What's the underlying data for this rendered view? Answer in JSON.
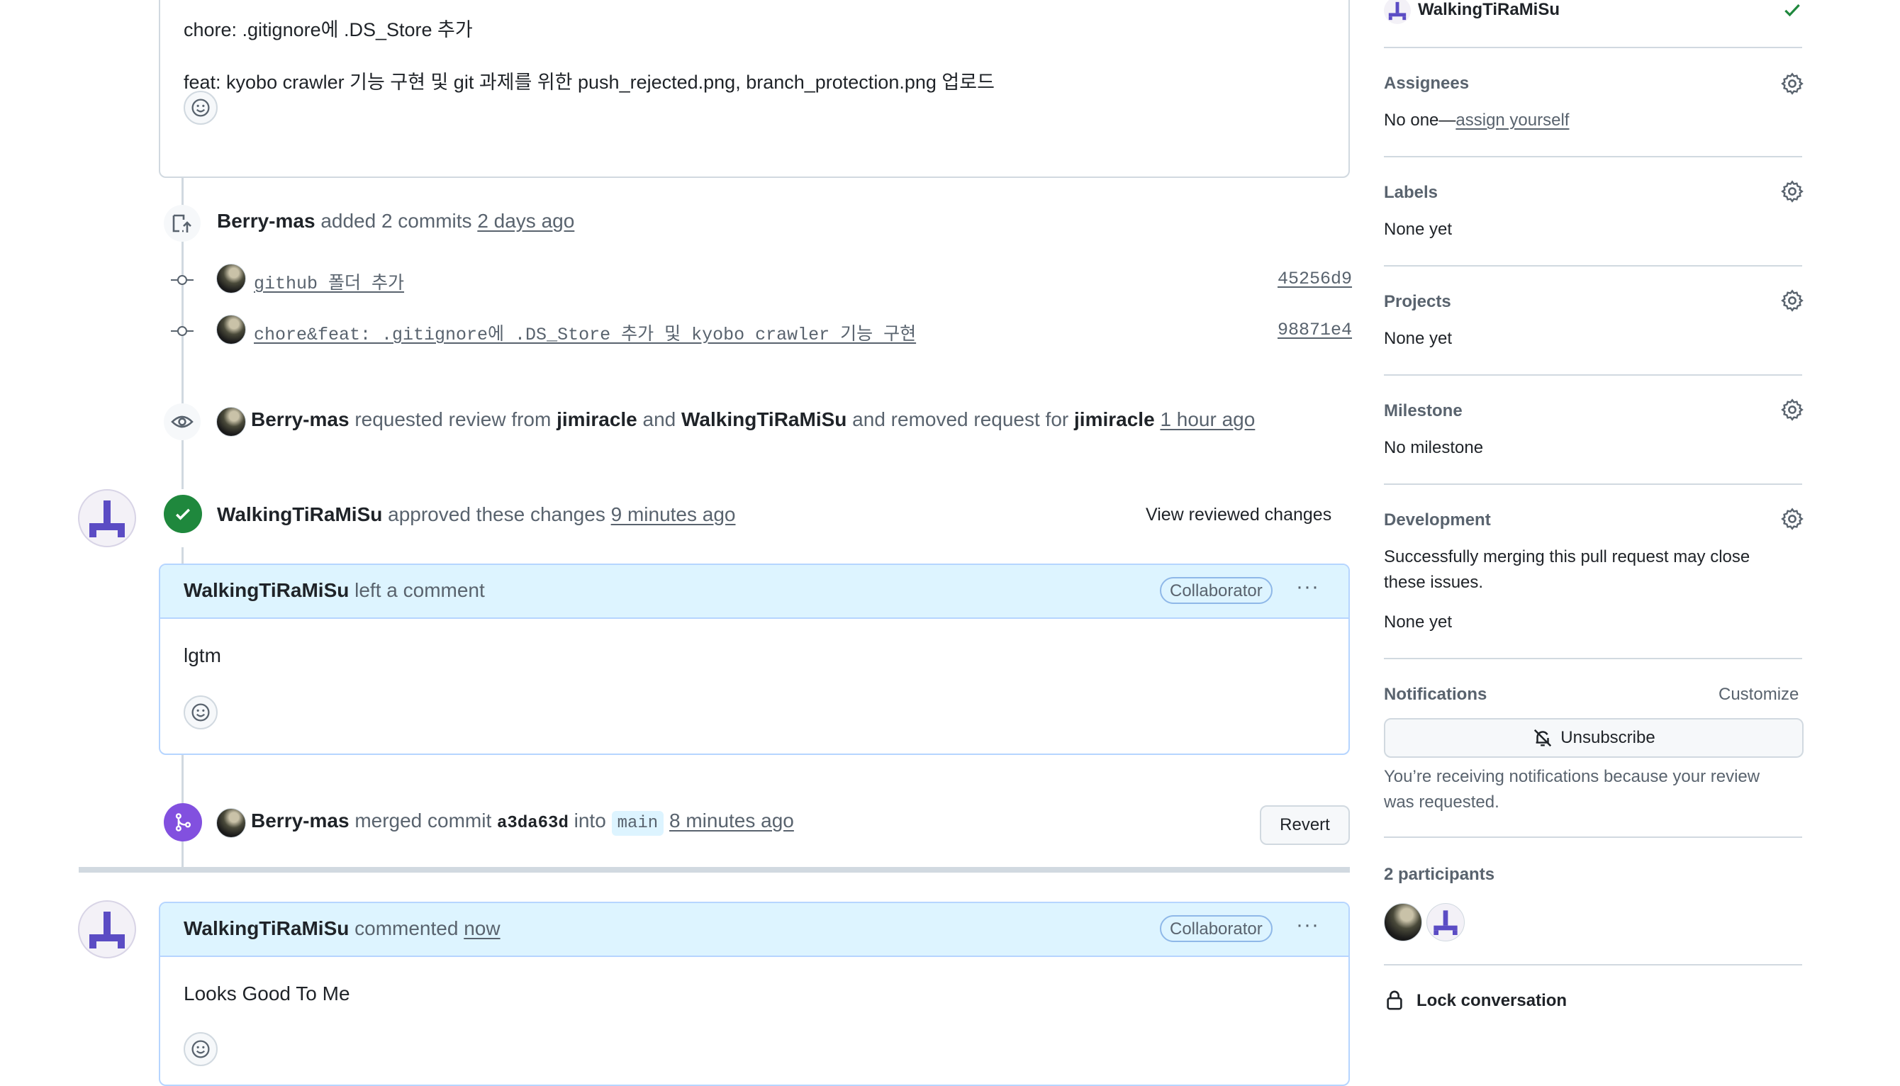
{
  "top_comment": {
    "line1": "chore: .gitignore에 .DS_Store 추가",
    "line2": "feat: kyobo crawler 기능 구현 및 git 과제를 위한 push_rejected.png, branch_protection.png 업로드"
  },
  "commits_event": {
    "author": "Berry-mas",
    "action": "added 2 commits",
    "time": "2 days ago",
    "commits": [
      {
        "message": "github 폴더 추가",
        "sha": "45256d9"
      },
      {
        "message": "chore&feat: .gitignore에 .DS_Store 추가 및 kyobo crawler 기능 구현",
        "sha": "98871e4"
      }
    ]
  },
  "review_request_event": {
    "author": "Berry-mas",
    "text1": "requested review from",
    "user1": "jimiracle",
    "text2": "and",
    "user2": "WalkingTiRaMiSu",
    "text3": "and removed request for",
    "user3": "jimiracle",
    "time": "1 hour ago"
  },
  "approval_event": {
    "author": "WalkingTiRaMiSu",
    "text": "approved these changes",
    "time": "9 minutes ago",
    "view_label": "View reviewed changes"
  },
  "review_comment": {
    "author": "WalkingTiRaMiSu",
    "action": "left a comment",
    "badge": "Collaborator",
    "more": "···",
    "body": "lgtm"
  },
  "merge_event": {
    "author": "Berry-mas",
    "text1": "merged commit",
    "commit": "a3da63d",
    "text2": "into",
    "branch": "main",
    "time": "8 minutes ago",
    "revert_label": "Revert"
  },
  "new_comment": {
    "author": "WalkingTiRaMiSu",
    "action": "commented",
    "time": "now",
    "badge": "Collaborator",
    "more": "···",
    "body": "Looks Good To Me"
  },
  "sidebar": {
    "reviewer": "WalkingTiRaMiSu",
    "assignees": {
      "title": "Assignees",
      "value_prefix": "No one—",
      "value_link": "assign yourself"
    },
    "labels": {
      "title": "Labels",
      "value": "None yet"
    },
    "projects": {
      "title": "Projects",
      "value": "None yet"
    },
    "milestone": {
      "title": "Milestone",
      "value": "No milestone"
    },
    "development": {
      "title": "Development",
      "line1": "Successfully merging this pull request may close",
      "line2": "these issues.",
      "value": "None yet"
    },
    "notifications": {
      "title": "Notifications",
      "customize": "Customize",
      "button": "Unsubscribe",
      "line1": "You’re receiving notifications because your review",
      "line2": "was requested."
    },
    "participants": {
      "title": "2 participants"
    },
    "lock": "Lock conversation"
  },
  "colors": {
    "success": "#1f883d",
    "merged": "#8250df",
    "accent_bg": "#ddf4ff"
  }
}
